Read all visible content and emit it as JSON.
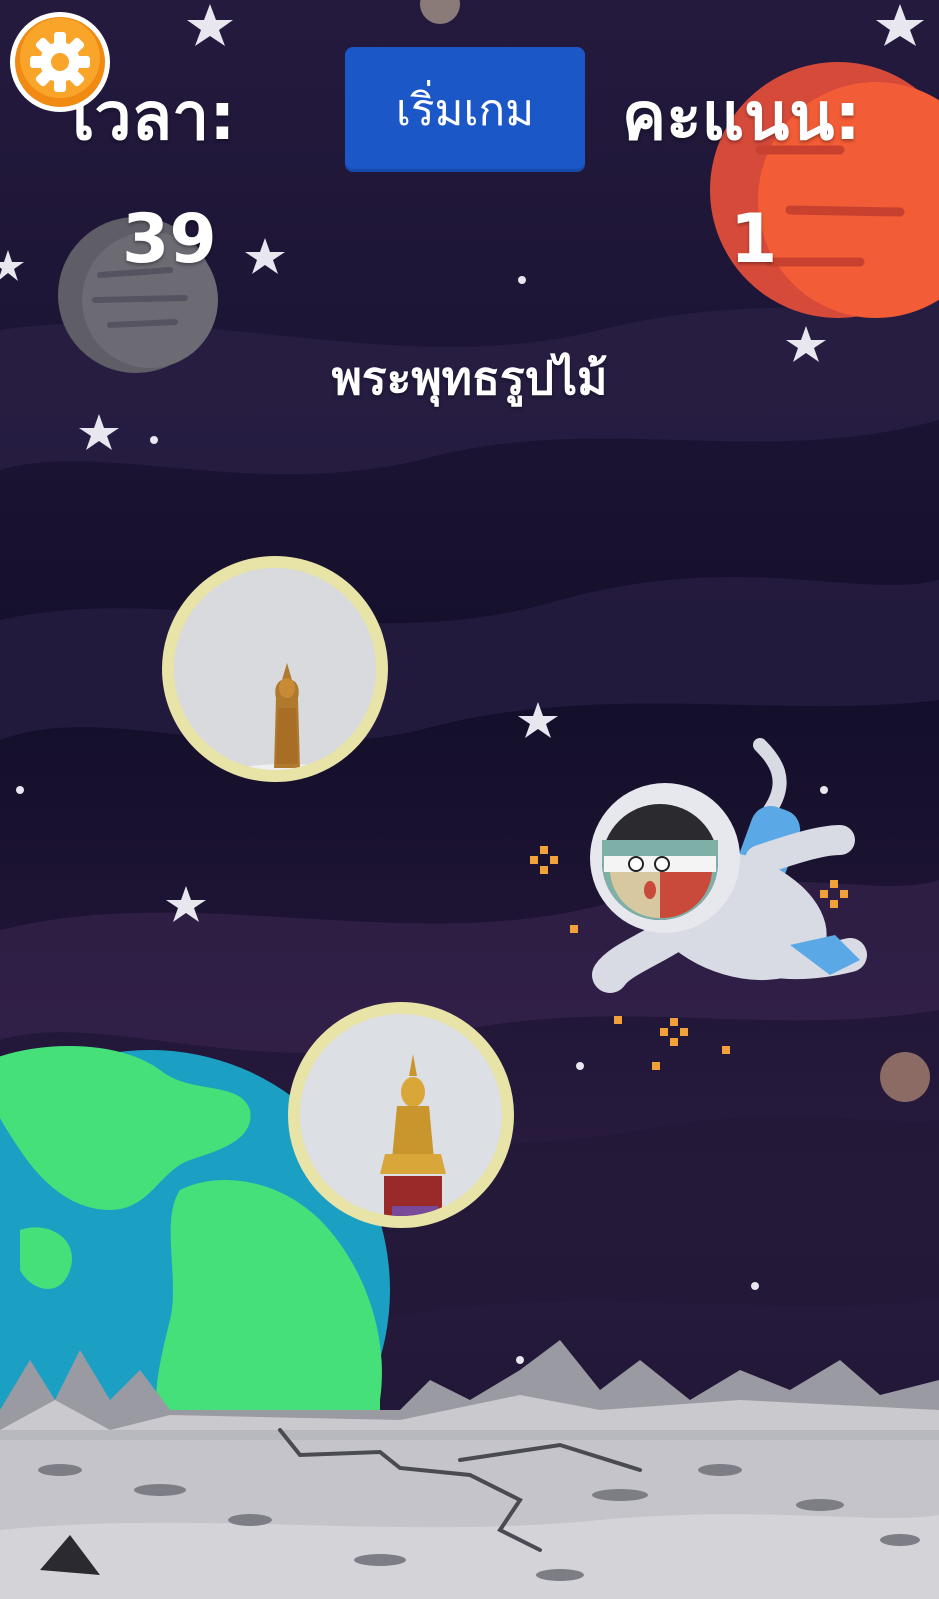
{
  "hud": {
    "time_label": "เวลา:",
    "time_value": "39",
    "score_label": "คะแนน:",
    "score_value": "1",
    "start_button_label": "เริ่มเกม"
  },
  "question": {
    "text": "พระพุทธรูปไม้"
  },
  "colors": {
    "sky": "#1a1430",
    "start_button": "#1c57c7",
    "choice_border": "#e8e3a6",
    "settings_orange": "#f59b1c"
  },
  "icons": {
    "settings": "gear-icon",
    "choice_1": "standing-wooden-buddha-image",
    "choice_2": "seated-gilded-buddha-image",
    "character": "astronaut",
    "planet_earth": "earth",
    "planet_mars": "red-planet"
  }
}
